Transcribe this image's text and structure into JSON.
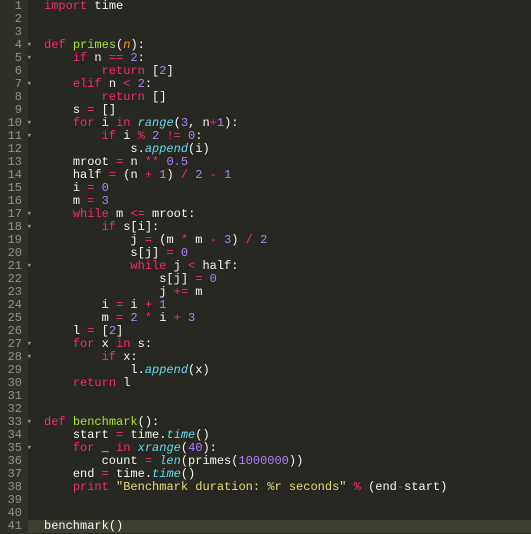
{
  "lines": [
    {
      "n": "1",
      "fold": "",
      "html": "<span class='kw'>import</span> <span class='plain'>time</span>"
    },
    {
      "n": "2",
      "fold": "",
      "html": ""
    },
    {
      "n": "3",
      "fold": "",
      "html": ""
    },
    {
      "n": "4",
      "fold": "▾",
      "html": "<span class='kw'>def</span> <span class='fn'>primes</span>(<span class='param'>n</span>):"
    },
    {
      "n": "5",
      "fold": "▾",
      "html": "    <span class='kw'>if</span> <span class='plain'>n</span> <span class='op'>==</span> <span class='num'>2</span>:"
    },
    {
      "n": "6",
      "fold": "",
      "html": "        <span class='kw'>return</span> [<span class='num'>2</span>]"
    },
    {
      "n": "7",
      "fold": "▾",
      "html": "    <span class='kw'>elif</span> <span class='plain'>n</span> <span class='op'>&lt;</span> <span class='num'>2</span>:"
    },
    {
      "n": "8",
      "fold": "",
      "html": "        <span class='kw'>return</span> []"
    },
    {
      "n": "9",
      "fold": "",
      "html": "    <span class='plain'>s</span> <span class='op'>=</span> []"
    },
    {
      "n": "10",
      "fold": "▾",
      "html": "    <span class='kw'>for</span> <span class='plain'>i</span> <span class='kw'>in</span> <span class='builtin'>range</span>(<span class='num'>3</span>, <span class='plain'>n</span><span class='op'>+</span><span class='num'>1</span>):"
    },
    {
      "n": "11",
      "fold": "▾",
      "html": "        <span class='kw'>if</span> <span class='plain'>i</span> <span class='op'>%</span> <span class='num'>2</span> <span class='op'>!=</span> <span class='num'>0</span>:"
    },
    {
      "n": "12",
      "fold": "",
      "html": "            <span class='plain'>s.</span><span class='builtin'>append</span>(<span class='plain'>i</span>)"
    },
    {
      "n": "13",
      "fold": "",
      "html": "    <span class='plain'>mroot</span> <span class='op'>=</span> <span class='plain'>n</span> <span class='op'>**</span> <span class='num'>0.5</span>"
    },
    {
      "n": "14",
      "fold": "",
      "html": "    <span class='plain'>half</span> <span class='op'>=</span> (<span class='plain'>n</span> <span class='op'>+</span> <span class='num'>1</span>) <span class='op'>/</span> <span class='num'>2</span> <span class='op'>-</span> <span class='num'>1</span>"
    },
    {
      "n": "15",
      "fold": "",
      "html": "    <span class='plain'>i</span> <span class='op'>=</span> <span class='num'>0</span>"
    },
    {
      "n": "16",
      "fold": "",
      "html": "    <span class='plain'>m</span> <span class='op'>=</span> <span class='num'>3</span>"
    },
    {
      "n": "17",
      "fold": "▾",
      "html": "    <span class='kw'>while</span> <span class='plain'>m</span> <span class='op'>&lt;=</span> <span class='plain'>mroot</span>:"
    },
    {
      "n": "18",
      "fold": "▾",
      "html": "        <span class='kw'>if</span> <span class='plain'>s</span>[<span class='plain'>i</span>]:"
    },
    {
      "n": "19",
      "fold": "",
      "html": "            <span class='plain'>j</span> <span class='op'>=</span> (<span class='plain'>m</span> <span class='op'>*</span> <span class='plain'>m</span> <span class='op'>-</span> <span class='num'>3</span>) <span class='op'>/</span> <span class='num'>2</span>"
    },
    {
      "n": "20",
      "fold": "",
      "html": "            <span class='plain'>s</span>[<span class='plain'>j</span>] <span class='op'>=</span> <span class='num'>0</span>"
    },
    {
      "n": "21",
      "fold": "▾",
      "html": "            <span class='kw'>while</span> <span class='plain'>j</span> <span class='op'>&lt;</span> <span class='plain'>half</span>:"
    },
    {
      "n": "22",
      "fold": "",
      "html": "                <span class='plain'>s</span>[<span class='plain'>j</span>] <span class='op'>=</span> <span class='num'>0</span>"
    },
    {
      "n": "23",
      "fold": "",
      "html": "                <span class='plain'>j</span> <span class='op'>+=</span> <span class='plain'>m</span>"
    },
    {
      "n": "24",
      "fold": "",
      "html": "        <span class='plain'>i</span> <span class='op'>=</span> <span class='plain'>i</span> <span class='op'>+</span> <span class='num'>1</span>"
    },
    {
      "n": "25",
      "fold": "",
      "html": "        <span class='plain'>m</span> <span class='op'>=</span> <span class='num'>2</span> <span class='op'>*</span> <span class='plain'>i</span> <span class='op'>+</span> <span class='num'>3</span>"
    },
    {
      "n": "26",
      "fold": "",
      "html": "    <span class='plain'>l</span> <span class='op'>=</span> [<span class='num'>2</span>]"
    },
    {
      "n": "27",
      "fold": "▾",
      "html": "    <span class='kw'>for</span> <span class='plain'>x</span> <span class='kw'>in</span> <span class='plain'>s</span>:"
    },
    {
      "n": "28",
      "fold": "▾",
      "html": "        <span class='kw'>if</span> <span class='plain'>x</span>:"
    },
    {
      "n": "29",
      "fold": "",
      "html": "            <span class='plain'>l.</span><span class='builtin'>append</span>(<span class='plain'>x</span>)"
    },
    {
      "n": "30",
      "fold": "",
      "html": "    <span class='kw'>return</span> <span class='plain'>l</span>"
    },
    {
      "n": "31",
      "fold": "",
      "html": ""
    },
    {
      "n": "32",
      "fold": "",
      "html": ""
    },
    {
      "n": "33",
      "fold": "▾",
      "html": "<span class='kw'>def</span> <span class='fn'>benchmark</span>():"
    },
    {
      "n": "34",
      "fold": "",
      "html": "    <span class='plain'>start</span> <span class='op'>=</span> <span class='plain'>time.</span><span class='builtin'>time</span>()"
    },
    {
      "n": "35",
      "fold": "▾",
      "html": "    <span class='kw'>for</span> <span class='plain'>_</span> <span class='kw'>in</span> <span class='builtin'>xrange</span>(<span class='num'>40</span>):"
    },
    {
      "n": "36",
      "fold": "",
      "html": "        <span class='plain'>count</span> <span class='op'>=</span> <span class='builtin'>len</span>(<span class='plain'>primes</span>(<span class='num'>1000000</span>))"
    },
    {
      "n": "37",
      "fold": "",
      "html": "    <span class='plain'>end</span> <span class='op'>=</span> <span class='plain'>time.</span><span class='builtin'>time</span>()"
    },
    {
      "n": "38",
      "fold": "",
      "html": "    <span class='kw'>print</span> <span class='str'>\"Benchmark duration: %r seconds\"</span> <span class='op'>%</span> (<span class='plain'>end</span><span class='op'>-</span><span class='plain'>start</span>)"
    },
    {
      "n": "39",
      "fold": "",
      "html": ""
    },
    {
      "n": "40",
      "fold": "",
      "html": ""
    },
    {
      "n": "41",
      "fold": "",
      "html": "<span class='plain'>benchmark</span>()",
      "hl": true
    }
  ]
}
